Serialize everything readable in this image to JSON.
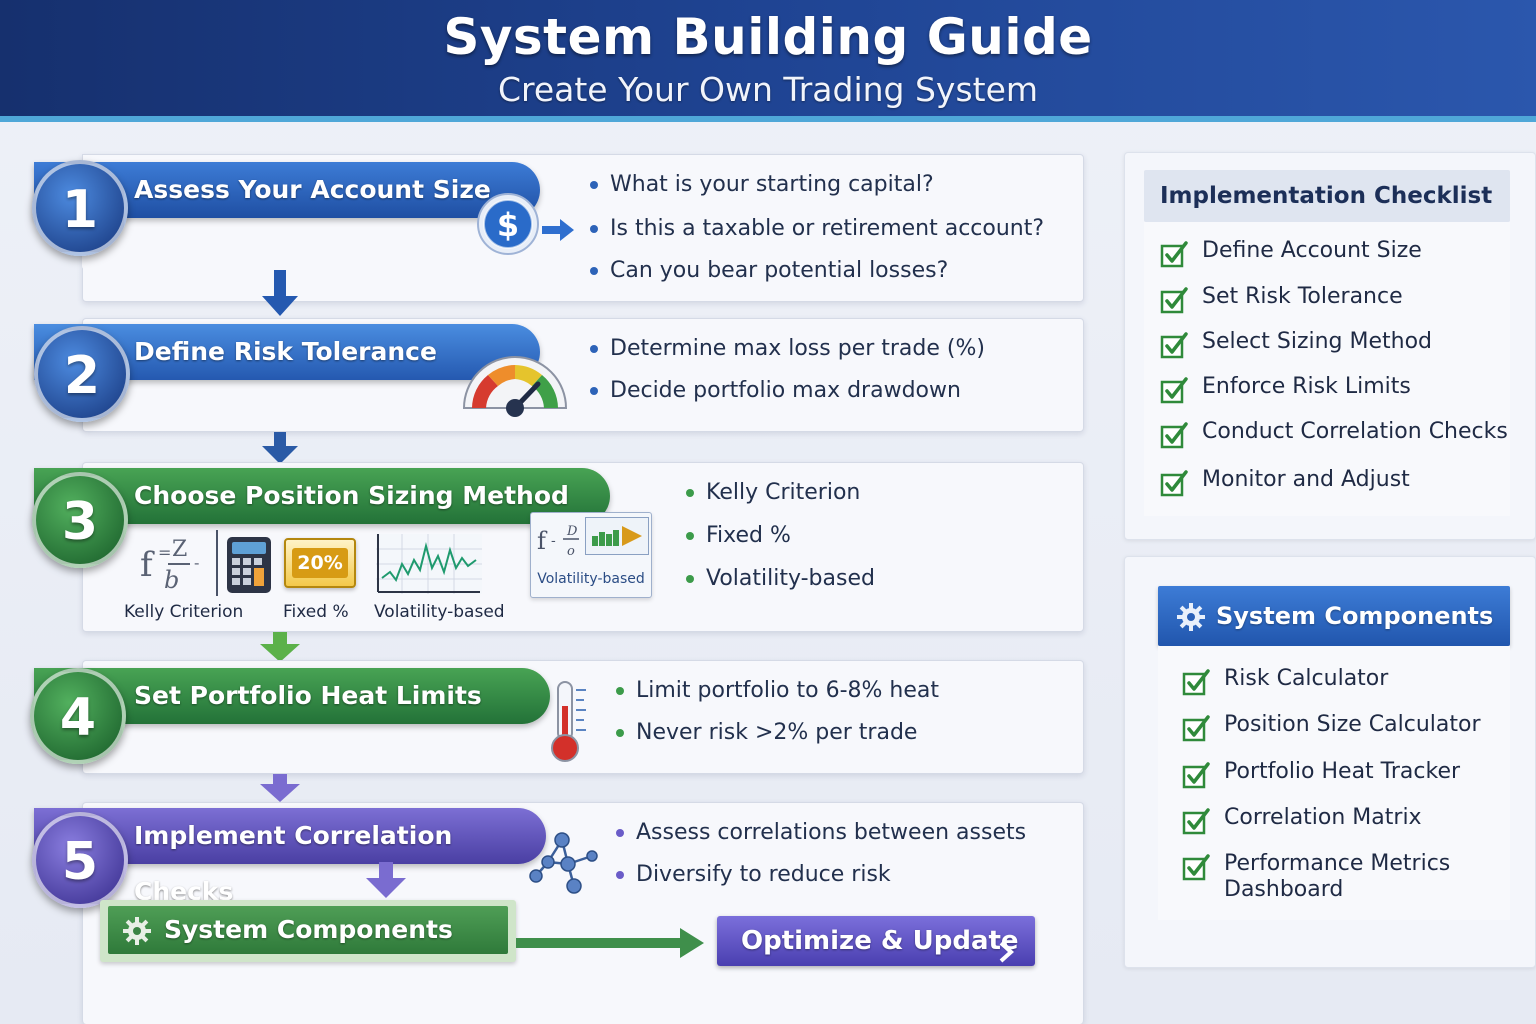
{
  "header": {
    "title": "System Building Guide",
    "subtitle": "Create Your Own Trading System"
  },
  "colors": {
    "header_bg": "#1f4493",
    "accent_cyan": "#4fa7d8",
    "step_blue": "#2559b0",
    "step_green": "#237238",
    "step_purple": "#4a3fa3",
    "check_green": "#2f8a3a"
  },
  "steps": [
    {
      "number": "1",
      "title": "Assess Your Account Size",
      "icon": "dollar-coin-icon",
      "bullets": [
        "What is your starting capital?",
        "Is this a taxable or retirement account?",
        "Can you bear potential losses?"
      ]
    },
    {
      "number": "2",
      "title": "Define Risk Tolerance",
      "icon": "gauge-icon",
      "bullets": [
        "Determine max loss per trade (%)",
        "Decide portfolio max drawdown"
      ]
    },
    {
      "number": "3",
      "title": "Choose Position Sizing Method",
      "icon": "sizing-methods-icons",
      "method_labels": [
        "Kelly Criterion",
        "Fixed %",
        "Volatility-based"
      ],
      "fixed_badge": "20%",
      "vol_tag": "Volatility-based",
      "bullets": [
        "Kelly Criterion",
        "Fixed %",
        "Volatility-based"
      ]
    },
    {
      "number": "4",
      "title": "Set Portfolio Heat Limits",
      "icon": "thermometer-icon",
      "bullets": [
        "Limit portfolio to 6-8% heat",
        "Never risk >2% per trade"
      ]
    },
    {
      "number": "5",
      "title": "Implement Correlation Checks",
      "icon": "network-icon",
      "bullets": [
        "Assess correlations between assets",
        "Diversify to reduce risk"
      ]
    }
  ],
  "bottom": {
    "components_label": "System Components",
    "optimize_label": "Optimize & Update"
  },
  "checklist": {
    "title": "Implementation Checklist",
    "items": [
      "Define Account Size",
      "Set Risk Tolerance",
      "Select Sizing Method",
      "Enforce Risk Limits",
      "Conduct Correlation Checks",
      "Monitor and Adjust"
    ]
  },
  "components": {
    "title": "System Components",
    "items": [
      "Risk Calculator",
      "Position Size Calculator",
      "Portfolio Heat Tracker",
      "Correlation Matrix",
      "Performance Metrics Dashboard"
    ]
  }
}
